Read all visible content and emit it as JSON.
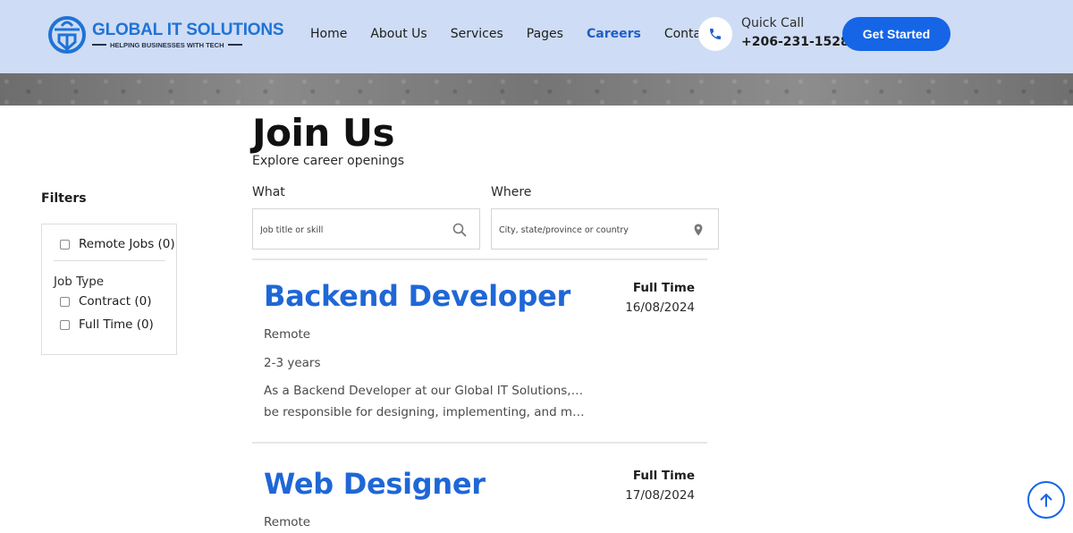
{
  "brand": {
    "name": "GLOBAL IT SOLUTIONS",
    "tagline": "HELPING BUSINESSES WITH TECH",
    "color": "#1f73d6",
    "icon": "globe-shield-logo-icon"
  },
  "nav": {
    "items": [
      {
        "label": "Home"
      },
      {
        "label": "About Us"
      },
      {
        "label": "Services"
      },
      {
        "label": "Pages"
      },
      {
        "label": "Careers",
        "active": true
      },
      {
        "label": "Contact"
      }
    ],
    "active_color": "#1f5fc8"
  },
  "quick_call": {
    "label": "Quick Call",
    "number": "+206-231-1528",
    "icon": "phone-icon"
  },
  "cta": {
    "label": "Get Started",
    "color": "#1565e6"
  },
  "page": {
    "title": "Join Us",
    "subtitle": "Explore career openings"
  },
  "filters": {
    "title": "Filters",
    "remote_label": "Remote Jobs (0)",
    "job_type_label": "Job Type",
    "job_type_options": [
      {
        "label": "Contract (0)"
      },
      {
        "label": "Full Time (0)"
      }
    ]
  },
  "search": {
    "what_label": "What",
    "what_placeholder": "Job title or skill",
    "what_icon": "search-icon",
    "where_label": "Where",
    "where_placeholder": "City, state/province or country",
    "where_icon": "map-pin-icon"
  },
  "jobs": [
    {
      "title": "Backend Developer",
      "type": "Full Time",
      "date": "16/08/2024",
      "location": "Remote",
      "experience": "2-3 years",
      "description_line1": "As a Backend Developer at our Global IT Solutions, you will",
      "description_line2": "be responsible for designing, implementing, and maintaining the server-side"
    },
    {
      "title": "Web Designer",
      "type": "Full Time",
      "date": "17/08/2024",
      "location": "Remote"
    }
  ],
  "scroll_top_icon": "arrow-up-icon"
}
